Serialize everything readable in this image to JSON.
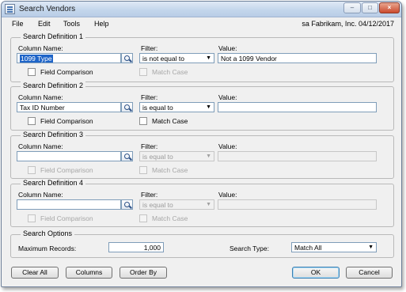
{
  "window": {
    "title": "Search Vendors"
  },
  "caption_buttons": {
    "minimize": "–",
    "maximize": "□",
    "close": "×"
  },
  "menu": [
    "File",
    "Edit",
    "Tools",
    "Help"
  ],
  "user_info": "sa  Fabrikam, Inc.  04/12/2017",
  "labels": {
    "column_name": "Column Name:",
    "filter": "Filter:",
    "value": "Value:",
    "field_comparison": "Field Comparison",
    "match_case": "Match Case"
  },
  "definitions": [
    {
      "title": "Search Definition 1",
      "column": "1099 Type",
      "filter": "is not equal to",
      "value": "Not a 1099 Vendor",
      "enabled": true
    },
    {
      "title": "Search Definition 2",
      "column": "Tax ID Number",
      "filter": "is equal to",
      "value": "",
      "enabled": true
    },
    {
      "title": "Search Definition 3",
      "column": "",
      "filter": "is equal to",
      "value": "",
      "enabled": false
    },
    {
      "title": "Search Definition 4",
      "column": "",
      "filter": "is equal to",
      "value": "",
      "enabled": false
    }
  ],
  "search_options": {
    "title": "Search Options",
    "max_records_label": "Maximum Records:",
    "max_records_value": "1,000",
    "search_type_label": "Search Type:",
    "search_type_value": "Match All"
  },
  "buttons": {
    "clear_all": "Clear All",
    "columns": "Columns",
    "order_by": "Order By",
    "ok": "OK",
    "cancel": "Cancel"
  },
  "colors": {
    "selection": "#1e64c8",
    "titlebar": "#c4d6ec",
    "window_bg": "#f0f0f0"
  },
  "icons": {
    "lookup": "magnifier-icon",
    "dropdown": "chevron-down-icon"
  }
}
